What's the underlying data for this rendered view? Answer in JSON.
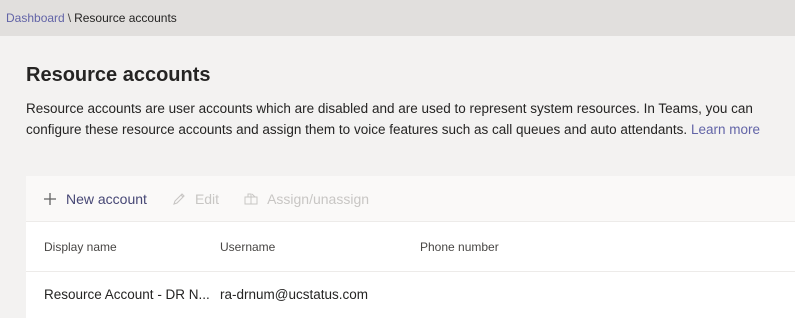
{
  "breadcrumb": {
    "parent": "Dashboard",
    "separator": "\\",
    "current": "Resource accounts"
  },
  "page": {
    "title": "Resource accounts",
    "description": "Resource accounts are user accounts which are disabled and are used to represent system resources. In Teams, you can configure these resource accounts and assign them to voice features such as call queues and auto attendants.",
    "learn_more": "Learn more"
  },
  "toolbar": {
    "new_account": "New account",
    "edit": "Edit",
    "assign": "Assign/unassign"
  },
  "table": {
    "headers": [
      "Display name",
      "Username",
      "Phone number"
    ],
    "rows": [
      {
        "display_name": "Resource Account - DR N...",
        "username": "ra-drnum@ucstatus.com",
        "phone": ""
      }
    ]
  },
  "colors": {
    "accent": "#6264a7",
    "disabled": "#c8c6c4"
  }
}
